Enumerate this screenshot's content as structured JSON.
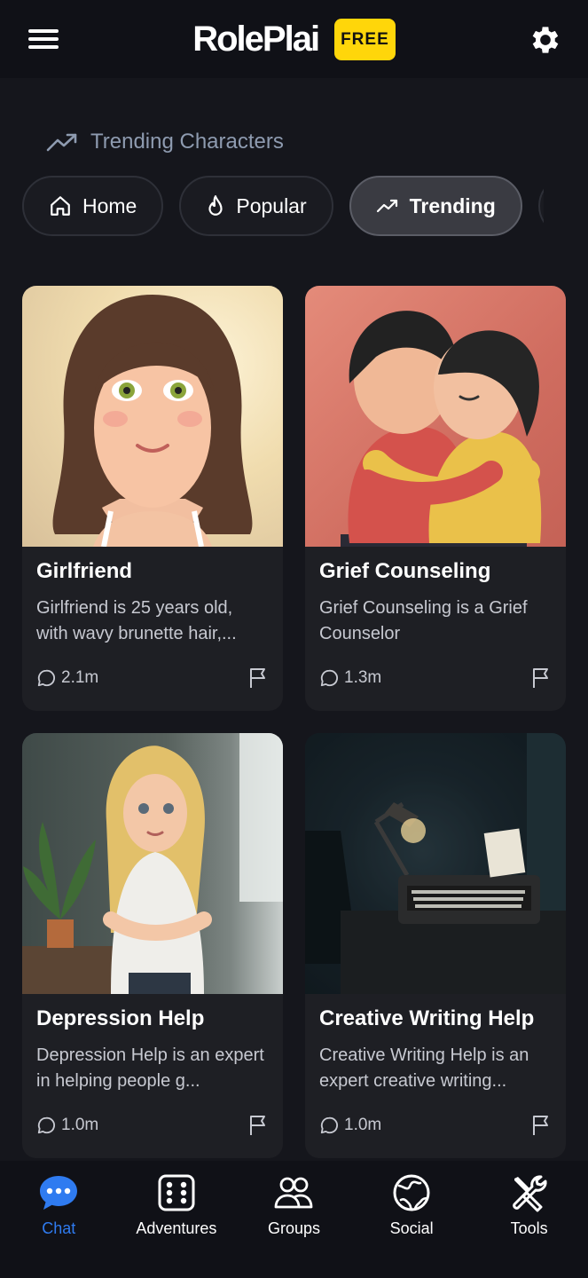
{
  "header": {
    "logo": "RolePlai",
    "badge": "FREE"
  },
  "section": {
    "title": "Trending Characters"
  },
  "filters": [
    {
      "label": "Home",
      "icon": "home-icon"
    },
    {
      "label": "Popular",
      "icon": "flame-icon"
    },
    {
      "label": "Trending",
      "icon": "trending-icon",
      "active": true
    }
  ],
  "cards": [
    {
      "title": "Girlfriend",
      "description": "Girlfriend is 25 years old, with wavy brunette hair,...",
      "count": "2.1m"
    },
    {
      "title": "Grief Counseling",
      "description": "Grief Counseling is a Grief Counselor",
      "count": "1.3m"
    },
    {
      "title": "Depression Help",
      "description": "Depression Help is an expert in helping people g...",
      "count": "1.0m"
    },
    {
      "title": "Creative Writing Help",
      "description": "Creative Writing Help is an expert creative writing...",
      "count": "1.0m"
    }
  ],
  "nav": [
    {
      "label": "Chat",
      "icon": "chat-bubble-icon",
      "active": true
    },
    {
      "label": "Adventures",
      "icon": "dice-icon"
    },
    {
      "label": "Groups",
      "icon": "groups-icon"
    },
    {
      "label": "Social",
      "icon": "globe-icon"
    },
    {
      "label": "Tools",
      "icon": "tools-icon"
    }
  ],
  "colors": {
    "background": "#15161c",
    "accent": "#2f7bf0",
    "badge": "#ffd60a"
  }
}
